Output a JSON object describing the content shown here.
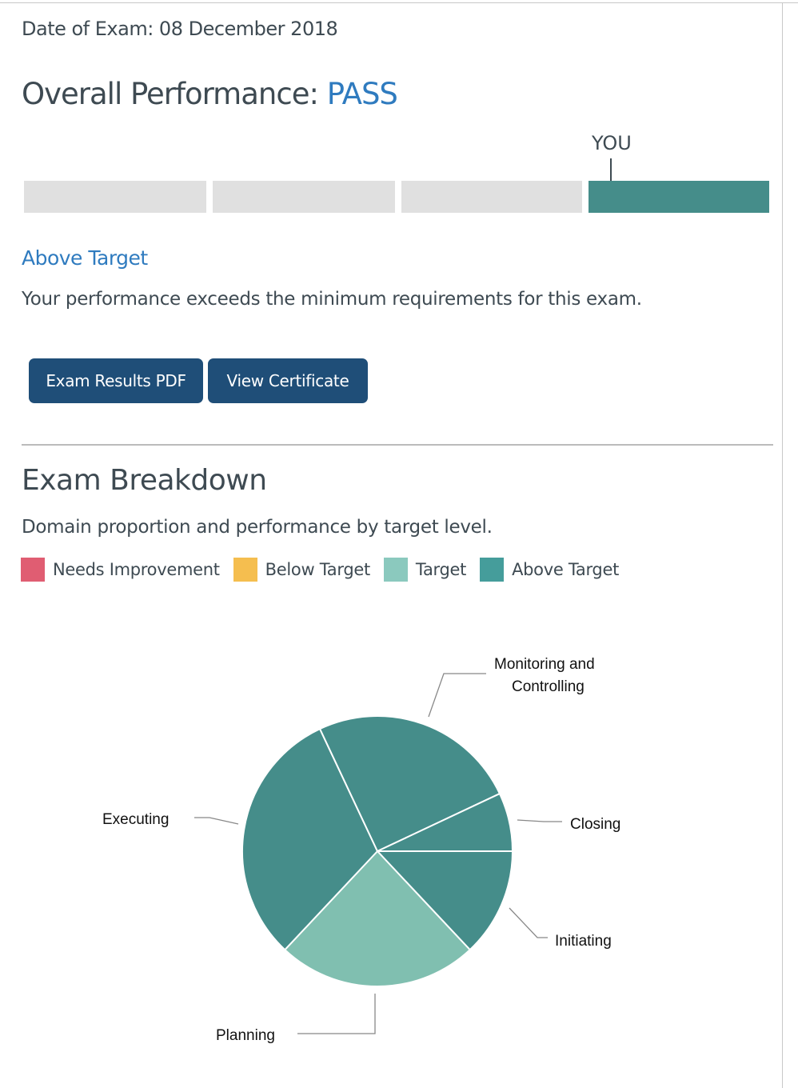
{
  "header": {
    "date_of_exam": "Date of Exam: 08 December 2018",
    "overall_label": "Overall Performance: ",
    "overall_result": "PASS"
  },
  "performance_bar": {
    "marker_label": "YOU",
    "segments": 4,
    "active_segment": 4,
    "active_color": "#458d8a",
    "inactive_color": "#e0e0e0"
  },
  "result": {
    "level": "Above Target",
    "description": "Your performance exceeds the minimum requirements for this exam."
  },
  "buttons": {
    "pdf": "Exam Results PDF",
    "certificate": "View Certificate"
  },
  "breakdown": {
    "title": "Exam Breakdown",
    "subtitle": "Domain proportion and performance by target level.",
    "legend": [
      {
        "label": "Needs Improvement",
        "color": "#e05d72"
      },
      {
        "label": "Below Target",
        "color": "#f5be4f"
      },
      {
        "label": "Target",
        "color": "#8bc9be"
      },
      {
        "label": "Above Target",
        "color": "#459d9b"
      }
    ]
  },
  "chart_data": {
    "type": "pie",
    "slices": [
      {
        "label": "Initiating",
        "value": 13,
        "level": "Above Target",
        "color": "#458d8a"
      },
      {
        "label": "Planning",
        "value": 24,
        "level": "Target",
        "color": "#80bfb0"
      },
      {
        "label": "Executing",
        "value": 31,
        "level": "Above Target",
        "color": "#458d8a"
      },
      {
        "label": "Monitoring and Controlling",
        "value": 25,
        "level": "Above Target",
        "color": "#458d8a"
      },
      {
        "label": "Closing",
        "value": 7,
        "level": "Above Target",
        "color": "#458d8a"
      }
    ]
  }
}
